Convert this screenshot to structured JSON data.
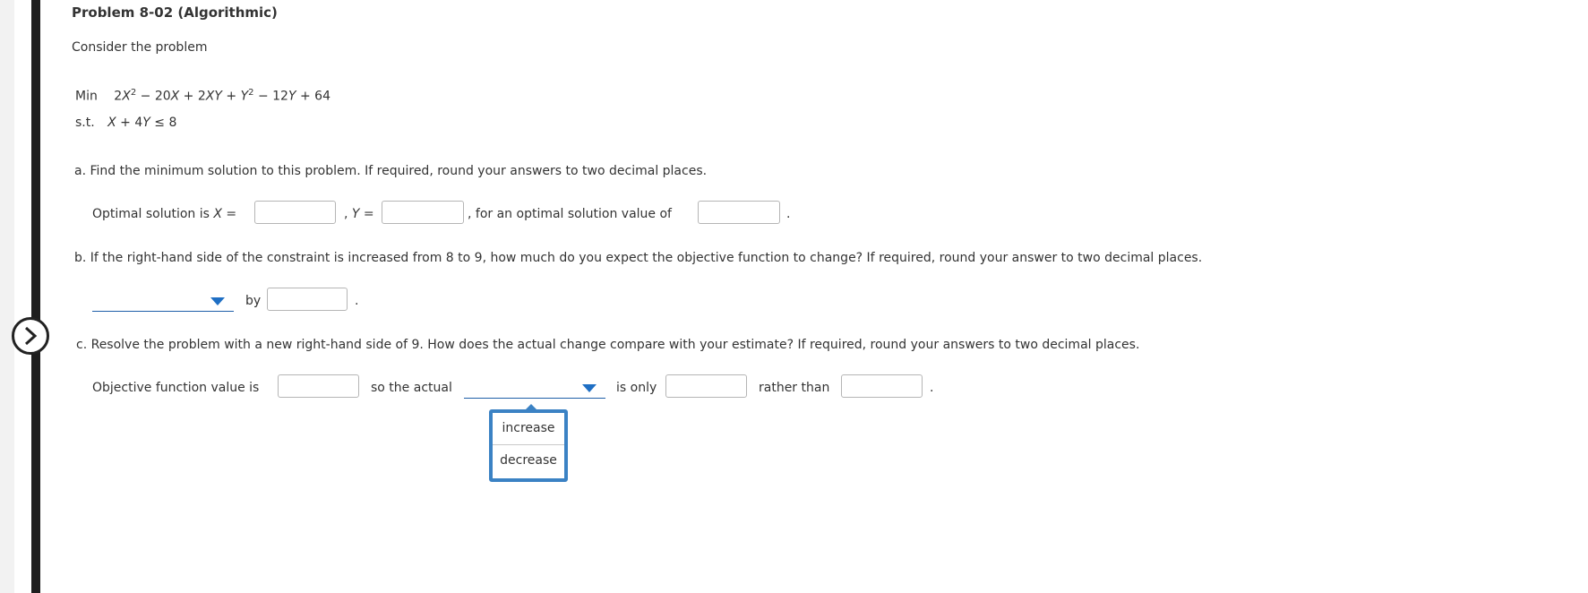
{
  "problem": {
    "title": "Problem 8-02 (Algorithmic)",
    "intro": "Consider the problem"
  },
  "formulation": {
    "min_label": "Min",
    "objective_prefix": "2",
    "objective_rest": " − 20",
    "objective_mid": " + 2",
    "objective_tail": " − 12",
    "objective_const": " + 64",
    "st_label": "s.t.",
    "constraint_rhs": " ≤ 8"
  },
  "part_a": {
    "question": "a. Find the minimum solution to this problem. If required, round your answers to two decimal places.",
    "optimal_label": "Optimal solution is",
    "x_var": "X",
    "eq": "=",
    "comma": ",",
    "y_var": "Y",
    "value_label": ", for an optimal solution value of",
    "end": "."
  },
  "part_b": {
    "question": "b. If the right-hand side of the constraint is increased from 8 to 9, how much do you expect the objective function to change? If required, round your answer to two decimal places.",
    "select_value": "",
    "by_label": "by",
    "end": "."
  },
  "part_c": {
    "question": "c. Resolve the problem with a new right-hand side of 9. How does the actual change compare with your estimate? If required, round your answers to two decimal places.",
    "obj_label": "Objective function value is",
    "so_actual": "so the actual",
    "select_value": "",
    "is_only": "is only",
    "rather_than": "rather than",
    "end": ".",
    "dropdown_options": [
      "increase",
      "decrease"
    ]
  },
  "colors": {
    "accent": "#1f6fc4",
    "dropdown_border": "#3b82c4",
    "left_bar": "#1e1e1e"
  },
  "icons": {
    "nav": "chevron-right-icon"
  }
}
